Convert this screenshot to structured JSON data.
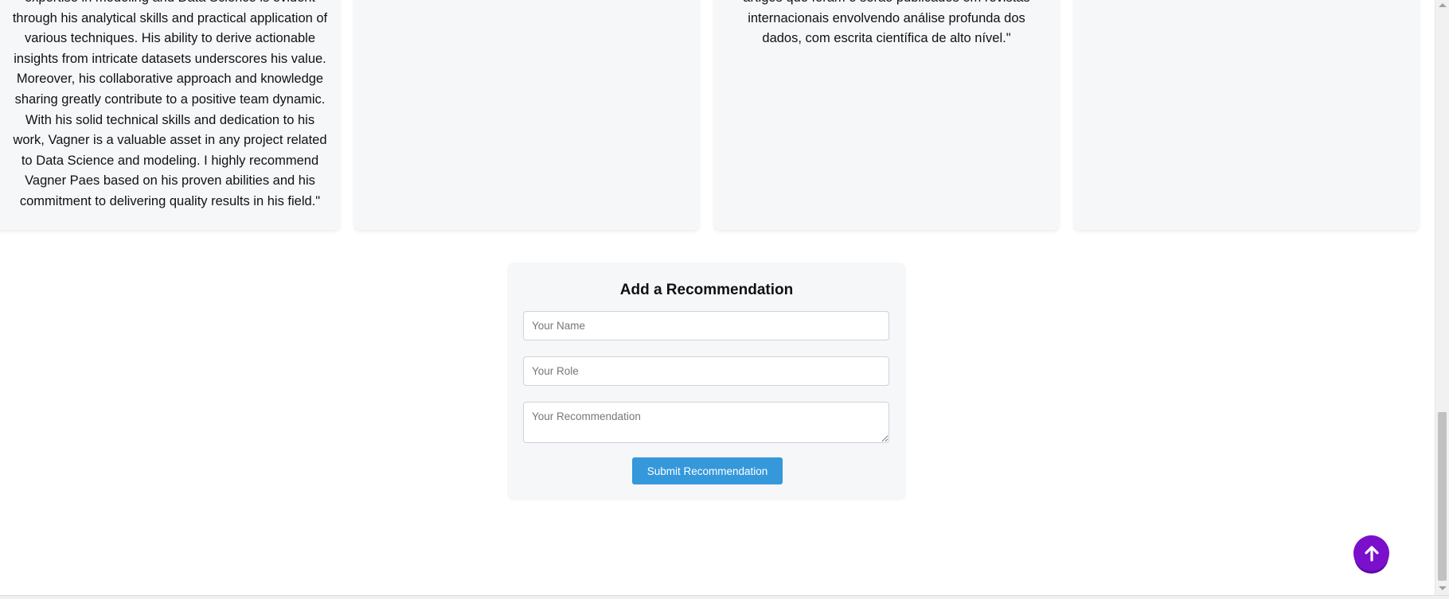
{
  "recommendations": {
    "cards": [
      {
        "text": "expertise in modeling and Data Science is evident through his analytical skills and practical application of various techniques. His ability to derive actionable insights from intricate datasets underscores his value. Moreover, his collaborative approach and knowledge sharing greatly contribute to a positive team dynamic. With his solid technical skills and dedication to his work, Vagner is a valuable asset in any project related to Data Science and modeling. I highly recommend Vagner Paes based on his proven abilities and his commitment to delivering quality results in his field.\""
      },
      {
        "text": ""
      },
      {
        "text": "artigos que foram e serão publicados em revistas internacionais envolvendo análise profunda dos dados, com escrita científica de alto nível.\""
      },
      {
        "text": ""
      }
    ]
  },
  "form": {
    "title": "Add a Recommendation",
    "name_placeholder": "Your Name",
    "role_placeholder": "Your Role",
    "recommendation_placeholder": "Your Recommendation",
    "submit_label": "Submit Recommendation",
    "name_value": "",
    "role_value": "",
    "recommendation_value": ""
  },
  "scroll_top": {
    "icon": "arrow-up-icon",
    "color": "#7a10cc"
  },
  "colors": {
    "accent": "#3498db",
    "card_bg": "#f6f7f9"
  }
}
